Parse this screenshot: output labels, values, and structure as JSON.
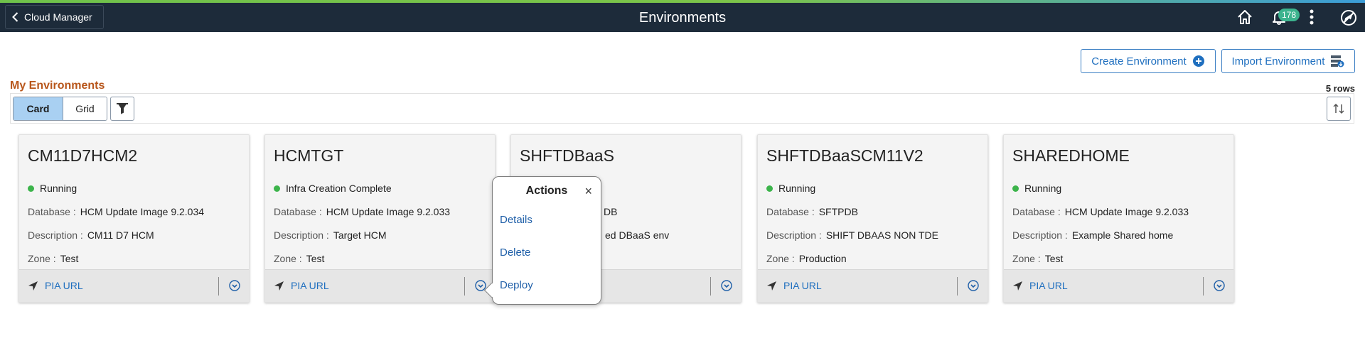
{
  "header": {
    "back_label": "Cloud Manager",
    "title": "Environments",
    "notification_count": "178",
    "icons": [
      "chevron-left-icon",
      "home-icon",
      "bell-icon",
      "kebab-menu-icon",
      "navbar-icon"
    ]
  },
  "actions_bar": {
    "create_label": "Create Environment",
    "import_label": "Import Environment"
  },
  "section": {
    "title": "My Environments",
    "rows": "5 rows"
  },
  "view_toggle": {
    "card_label": "Card",
    "grid_label": "Grid",
    "selected": "Card"
  },
  "cards": [
    {
      "name": "CM11D7HCM2",
      "status": "Running",
      "database": "HCM Update Image 9.2.034",
      "description": "CM11 D7 HCM",
      "zone": "Test",
      "link": "PIA URL"
    },
    {
      "name": "HCMTGT",
      "status": "Infra Creation Complete",
      "database": "HCM Update Image 9.2.033",
      "description": "Target HCM",
      "zone": "Test",
      "link": "PIA URL"
    },
    {
      "name": "SHFTDBaaS",
      "status": "",
      "database": "DB",
      "description": "ed DBaaS env",
      "zone": "",
      "link": ""
    },
    {
      "name": "SHFTDBaaSCM11V2",
      "status": "Running",
      "database": "SFTPDB",
      "description": "SHIFT DBAAS NON TDE",
      "zone": "Production",
      "link": "PIA URL"
    },
    {
      "name": "SHAREDHOME",
      "status": "Running",
      "database": "HCM Update Image 9.2.033",
      "description": "Example Shared home",
      "zone": "Test",
      "link": "PIA URL"
    }
  ],
  "labels": {
    "database": "Database :",
    "description": "Description :",
    "zone": "Zone :"
  },
  "popover": {
    "title": "Actions",
    "close": "×",
    "items": [
      "Details",
      "Delete",
      "Deploy"
    ]
  },
  "colors": {
    "header_bg": "#1d2b3a",
    "accent_blue": "#1f6fbf",
    "section_title": "#b8561b",
    "status_green": "#3cb44b",
    "badge_green": "#3cb38e",
    "toggle_selected": "#a9d0f2"
  }
}
